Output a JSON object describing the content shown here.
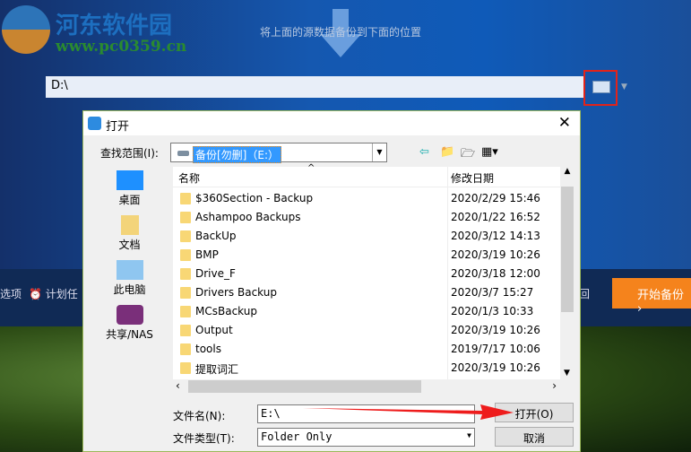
{
  "app": {
    "logo_text": "河东软件园",
    "logo_url": "www.pc0359.cn",
    "hint": "将上面的源数据备份到下面的位置",
    "dest_path": "D:\\",
    "options_label": "选项",
    "schedule_label": "计划任",
    "back_label": "回",
    "start_button": "开始备份 ›"
  },
  "dialog": {
    "title": "打开",
    "look_in_label": "查找范围(I):",
    "look_in_value": "备份[勿删]（E:）",
    "places": [
      "桌面",
      "文档",
      "此电脑",
      "共享/NAS"
    ],
    "columns": {
      "name": "名称",
      "date": "修改日期"
    },
    "files": [
      {
        "name": "$360Section - Backup",
        "date": "2020/2/29 15:46"
      },
      {
        "name": "Ashampoo Backups",
        "date": "2020/1/22 16:52"
      },
      {
        "name": "BackUp",
        "date": "2020/3/12 14:13"
      },
      {
        "name": "BMP",
        "date": "2020/3/19 10:26"
      },
      {
        "name": "Drive_F",
        "date": "2020/3/18 12:00"
      },
      {
        "name": "Drivers Backup",
        "date": "2020/3/7 15:27"
      },
      {
        "name": "MCsBackup",
        "date": "2020/1/3 10:33"
      },
      {
        "name": "Output",
        "date": "2020/3/19 10:26"
      },
      {
        "name": "tools",
        "date": "2019/7/17 10:06"
      },
      {
        "name": "提取词汇",
        "date": "2020/3/19 10:26"
      }
    ],
    "filename_label": "文件名(N):",
    "filename_value": "E:\\",
    "filetype_label": "文件类型(T):",
    "filetype_value": "Folder Only",
    "open_button": "打开(O)",
    "cancel_button": "取消"
  }
}
